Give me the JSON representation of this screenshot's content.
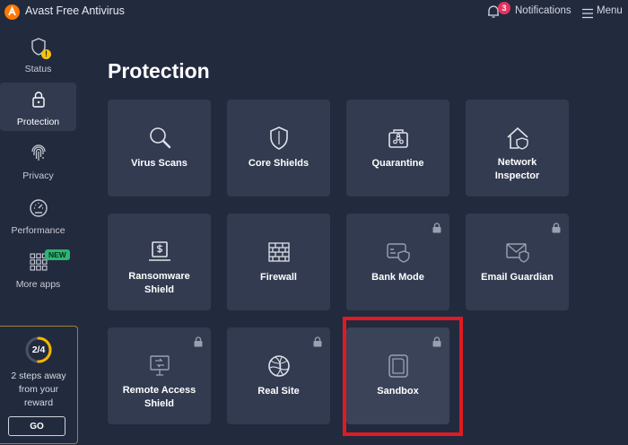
{
  "app": {
    "title": "Avast Free Antivirus",
    "accent": "#ff7800"
  },
  "header": {
    "notifications_count": "3",
    "notifications_label": "Notifications",
    "menu_label": "Menu"
  },
  "sidebar": {
    "items": [
      {
        "label": "Status",
        "icon": "shield-warning-icon",
        "warning": "!"
      },
      {
        "label": "Protection",
        "icon": "lock-icon",
        "active": true
      },
      {
        "label": "Privacy",
        "icon": "fingerprint-icon"
      },
      {
        "label": "Performance",
        "icon": "speedometer-icon"
      },
      {
        "label": "More apps",
        "icon": "grid-icon",
        "badge": "NEW"
      }
    ],
    "reward": {
      "progress": "2/4",
      "progress_fraction": 0.5,
      "text_lines": [
        "2 steps away",
        "from your",
        "reward"
      ],
      "go_label": "GO"
    }
  },
  "main": {
    "title": "Protection",
    "tiles": [
      {
        "label_lines": [
          "Virus Scans"
        ],
        "icon": "magnifier-icon",
        "locked": false
      },
      {
        "label_lines": [
          "Core Shields"
        ],
        "icon": "shield-icon",
        "locked": false
      },
      {
        "label_lines": [
          "Quarantine"
        ],
        "icon": "biohazard-chest-icon",
        "locked": false
      },
      {
        "label_lines": [
          "Network",
          "Inspector"
        ],
        "icon": "home-shield-icon",
        "locked": false
      },
      {
        "label_lines": [
          "Ransomware",
          "Shield"
        ],
        "icon": "laptop-dollar-icon",
        "locked": false
      },
      {
        "label_lines": [
          "Firewall"
        ],
        "icon": "brick-wall-icon",
        "locked": false
      },
      {
        "label_lines": [
          "Bank Mode"
        ],
        "icon": "card-shield-icon",
        "locked": true
      },
      {
        "label_lines": [
          "Email Guardian"
        ],
        "icon": "envelope-shield-icon",
        "locked": true
      },
      {
        "label_lines": [
          "Remote Access",
          "Shield"
        ],
        "icon": "remote-monitor-icon",
        "locked": true
      },
      {
        "label_lines": [
          "Real Site"
        ],
        "icon": "globe-icon",
        "locked": true
      },
      {
        "label_lines": [
          "Sandbox"
        ],
        "icon": "sandbox-icon",
        "locked": true,
        "highlighted": true
      }
    ]
  }
}
